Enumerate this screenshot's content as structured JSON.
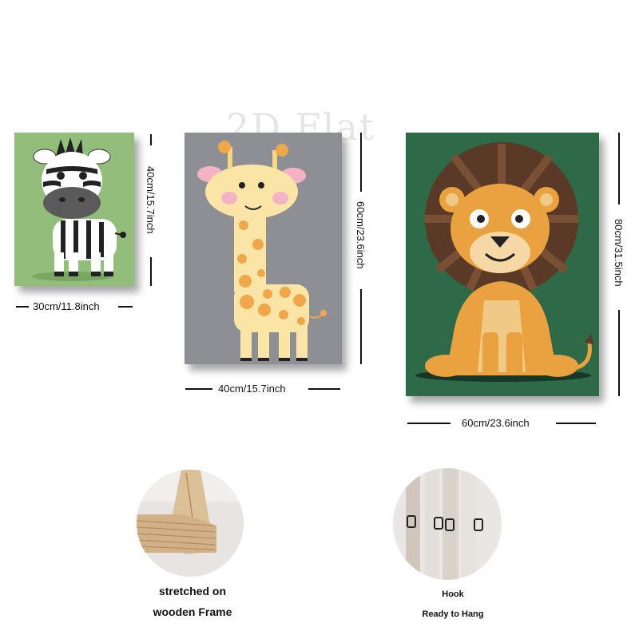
{
  "watermark": "2D Flat",
  "paintings": [
    {
      "animal": "zebra",
      "width_label": "30cm/11.8inch",
      "height_label": "40cm/15.7inch",
      "bg_color": "#93bd7b"
    },
    {
      "animal": "giraffe",
      "width_label": "40cm/15.7inch",
      "height_label": "60cm/23.6inch",
      "bg_color": "#8e8f95"
    },
    {
      "animal": "lion",
      "width_label": "60cm/23.6inch",
      "height_label": "80cm/31.5inch",
      "bg_color": "#2e6a48"
    }
  ],
  "features": [
    {
      "image": "wooden-frame-corner",
      "caption_line1": "stretched on",
      "caption_line2": "wooden Frame"
    },
    {
      "image": "hooks-on-frame",
      "caption_line1": "Hook",
      "caption_line2": "Ready to Hang"
    }
  ]
}
